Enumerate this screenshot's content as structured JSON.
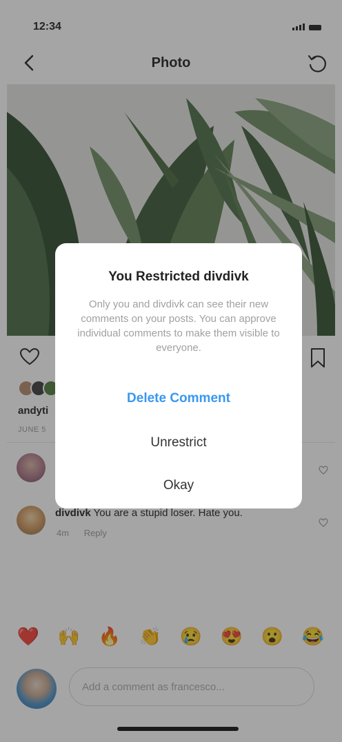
{
  "status_bar": {
    "time": "12:34"
  },
  "nav": {
    "title": "Photo"
  },
  "post": {
    "username": "andyti",
    "date": "JUNE 5"
  },
  "comments": [
    {
      "username": "divdivk",
      "text": "You are a stupid loser. Hate you.",
      "time": "4m",
      "reply_label": "Reply"
    }
  ],
  "emoji_bar": [
    "❤️",
    "🙌",
    "🔥",
    "👏",
    "😢",
    "😍",
    "😮",
    "😂"
  ],
  "composer": {
    "placeholder": "Add a comment as francesco..."
  },
  "modal": {
    "title": "You Restricted divdivk",
    "body": "Only you and divdivk can see their new comments on your posts. You can approve individual comments to make them visible to everyone.",
    "delete_label": "Delete Comment",
    "unrestrict_label": "Unrestrict",
    "okay_label": "Okay"
  },
  "colors": {
    "accent": "#3897f0",
    "overlay": "rgba(40,40,40,0.42)"
  },
  "icons": [
    "back-arrow-icon",
    "refresh-icon",
    "heart-icon",
    "bookmark-icon",
    "comment-heart-icon"
  ]
}
